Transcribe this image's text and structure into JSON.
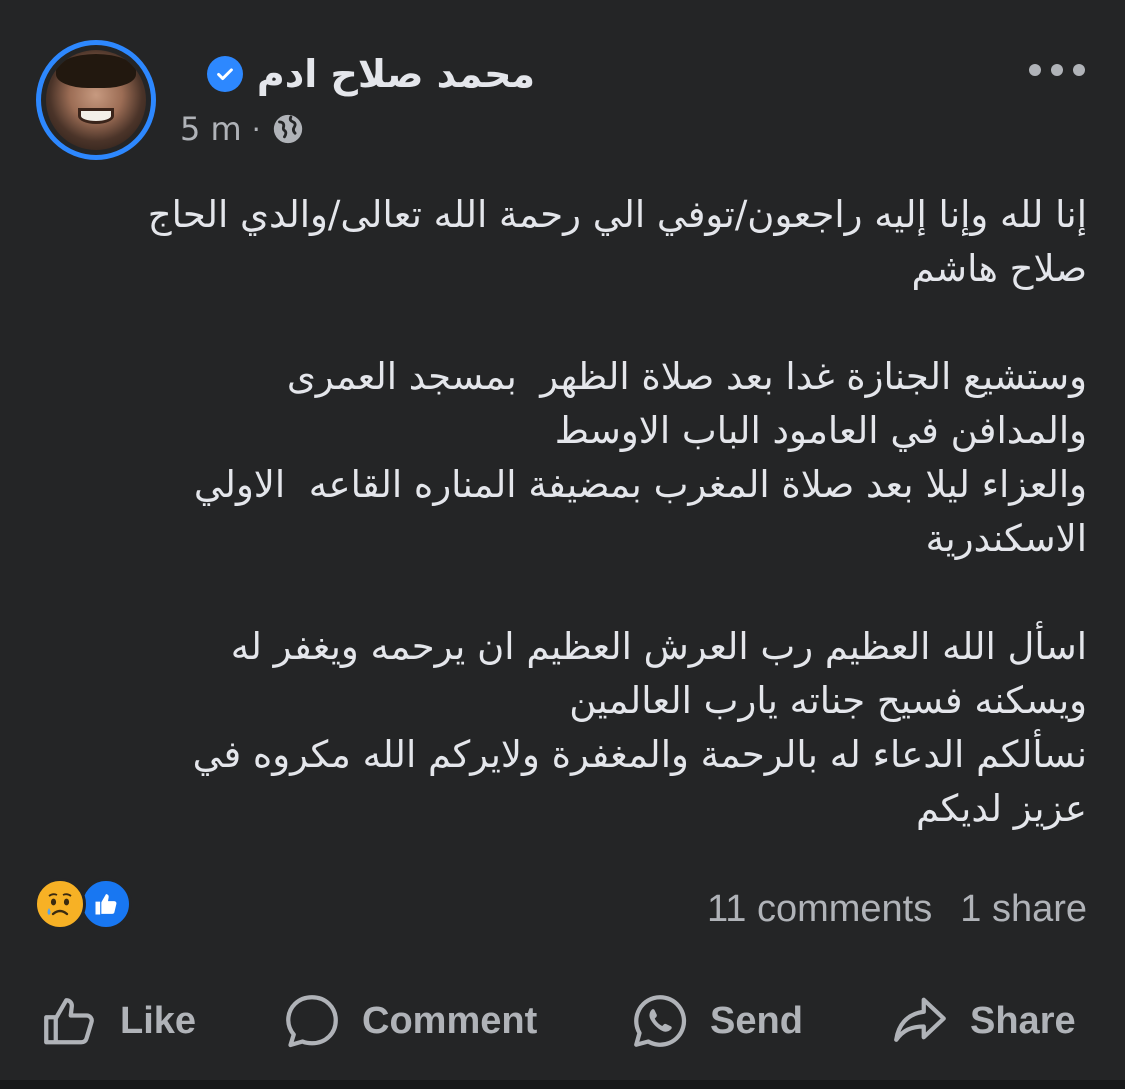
{
  "post": {
    "author": "محمد صلاح  ادم",
    "timestamp": "5 m",
    "separator": "·",
    "audience_icon": "globe-icon",
    "verified_icon": "verified-badge-icon",
    "text": "إنا لله وإنا إليه راجعون/توفي الي رحمة الله تعالى/والدي الحاج\nصلاح هاشم\n\nوستشيع الجنازة غدا بعد صلاة الظهر  بمسجد العمرى\nوالمدافن في العامود الباب الاوسط\nوالعزاء ليلا بعد صلاة المغرب بمضيفة المناره القاعه  الاولي\nالاسكندرية\n\nاسأل الله العظيم رب العرش العظيم ان يرحمه ويغفر له\nويسكنه فسيح جناته يارب العالمين\nنسألكم الدعاء له بالرحمة والمغفرة ولايركم الله مكروه في\nعزيز لديكم"
  },
  "reactions": {
    "icons": [
      "sad-reaction-icon",
      "like-reaction-icon"
    ],
    "comments": "11 comments",
    "shares": "1 share"
  },
  "actions": {
    "like": "Like",
    "comment": "Comment",
    "send": "Send",
    "share": "Share"
  },
  "colors": {
    "background": "#242526",
    "text": "#e4e6eb",
    "secondary": "#b0b3b8",
    "accent": "#2d88ff"
  }
}
